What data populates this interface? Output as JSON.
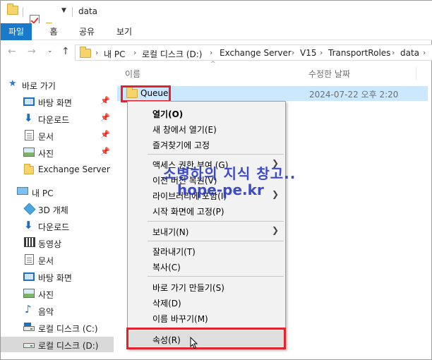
{
  "window": {
    "title": "data"
  },
  "ribbon": {
    "tabs": [
      {
        "label": "파일",
        "active": true
      },
      {
        "label": "홈"
      },
      {
        "label": "공유"
      },
      {
        "label": "보기"
      }
    ]
  },
  "address": {
    "crumbs": [
      "내 PC",
      "로컬 디스크 (D:)",
      "Exchange Server",
      "V15",
      "TransportRoles",
      "data"
    ]
  },
  "sidebar": {
    "quick_access": "바로 가기",
    "items": [
      {
        "label": "바탕 화면",
        "icon": "desktop-icon",
        "pinned": true
      },
      {
        "label": "다운로드",
        "icon": "download-icon",
        "pinned": true
      },
      {
        "label": "문서",
        "icon": "documents-icon",
        "pinned": true
      },
      {
        "label": "사진",
        "icon": "pictures-icon",
        "pinned": true
      },
      {
        "label": "Exchange Server",
        "icon": "folder-icon",
        "pinned": false
      }
    ],
    "this_pc": "내 PC",
    "pc_items": [
      {
        "label": "3D 개체",
        "icon": "3d-objects-icon"
      },
      {
        "label": "다운로드",
        "icon": "download-icon"
      },
      {
        "label": "동영상",
        "icon": "videos-icon"
      },
      {
        "label": "문서",
        "icon": "documents-icon"
      },
      {
        "label": "바탕 화면",
        "icon": "desktop-icon"
      },
      {
        "label": "사진",
        "icon": "pictures-icon"
      },
      {
        "label": "음악",
        "icon": "music-icon"
      },
      {
        "label": "로컬 디스크 (C:)",
        "icon": "drive-icon"
      },
      {
        "label": "로컬 디스크 (D:)",
        "icon": "drive-icon",
        "selected": true
      }
    ]
  },
  "list": {
    "columns": {
      "name": "이름",
      "modified": "수정한 날짜"
    },
    "rows": [
      {
        "name": "Queue",
        "modified": "2024-07-22 오후 2:20"
      }
    ]
  },
  "context_menu": {
    "items": [
      {
        "label": "열기(O)",
        "bold": true
      },
      {
        "label": "새 창에서 열기(E)"
      },
      {
        "label": "즐겨찾기에 고정"
      },
      {
        "label": "액세스 권한 부여 (G)",
        "submenu": true
      },
      {
        "label": "이전 버전 복원(V)"
      },
      {
        "label": "라이브러리에 포함(I)",
        "submenu": true
      },
      {
        "label": "시작 화면에 고정(P)"
      },
      {
        "label": "보내기(N)",
        "submenu": true
      },
      {
        "label": "잘라내기(T)"
      },
      {
        "label": "복사(C)"
      },
      {
        "label": "바로 가기 만들기(S)"
      },
      {
        "label": "삭제(D)"
      },
      {
        "label": "이름 바꾸기(M)"
      },
      {
        "label": "속성(R)",
        "hover": true
      }
    ]
  },
  "watermark": {
    "line1": "소병하의 지식 창고..",
    "line2": "hope-pe.kr"
  },
  "colors": {
    "accent": "#1979ca",
    "highlight": "#e0232e",
    "selection": "#cce8ff"
  }
}
